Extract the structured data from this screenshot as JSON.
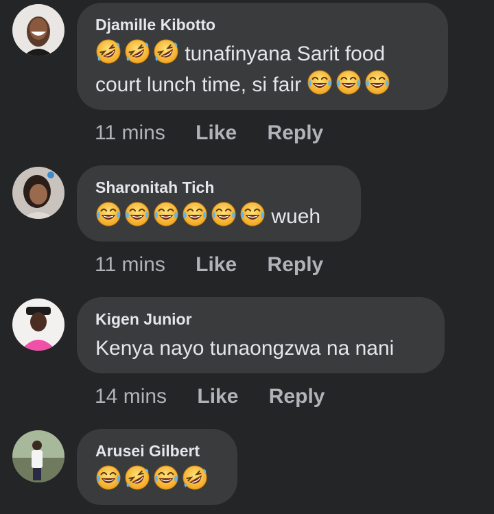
{
  "comments": [
    {
      "author": "Djamille Kibotto",
      "text_prefix": "tunafinyana Sarit food court lunch time, si fair",
      "time": "11 mins",
      "like_label": "Like",
      "reply_label": "Reply"
    },
    {
      "author": "Sharonitah Tich",
      "text_suffix": "wueh",
      "time": "11 mins",
      "like_label": "Like",
      "reply_label": "Reply"
    },
    {
      "author": "Kigen Junior",
      "text": "Kenya nayo tunaongzwa na nani",
      "time": "14 mins",
      "like_label": "Like",
      "reply_label": "Reply"
    },
    {
      "author": "Arusei Gilbert"
    }
  ],
  "colors": {
    "background": "#242527",
    "bubble": "#3a3b3c",
    "text": "#e4e6eb",
    "muted": "#b0b3b8",
    "emoji_face": "#f7c43a"
  }
}
